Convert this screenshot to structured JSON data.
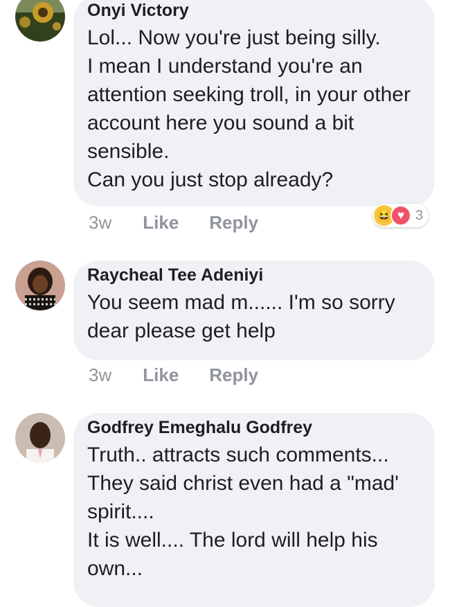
{
  "comments": [
    {
      "author": "Onyi Victory",
      "text": "Lol... Now you're just being silly.\nI mean I understand you're an attention seeking troll, in your other account here you sound a bit sensible.\nCan you just stop already?",
      "time": "3w",
      "like_label": "Like",
      "reply_label": "Reply",
      "reactions": {
        "icons": [
          "haha-icon",
          "love-icon"
        ],
        "count": "3"
      },
      "avatar_colors": [
        "#3d4a22",
        "#c8a236"
      ]
    },
    {
      "author": "Raycheal Tee Adeniyi",
      "text": "You seem mad m...... I'm so sorry dear please get help",
      "time": "3w",
      "like_label": "Like",
      "reply_label": "Reply",
      "avatar_colors": [
        "#2b1a12",
        "#7d4a2a"
      ]
    },
    {
      "author": "Godfrey Emeghalu Godfrey",
      "text": "Truth.. attracts such comments...   They said christ even had a \"mad' spirit....\nIt is well....   The lord will help his own...",
      "avatar_colors": [
        "#3a2418",
        "#c7b7a8"
      ]
    }
  ]
}
